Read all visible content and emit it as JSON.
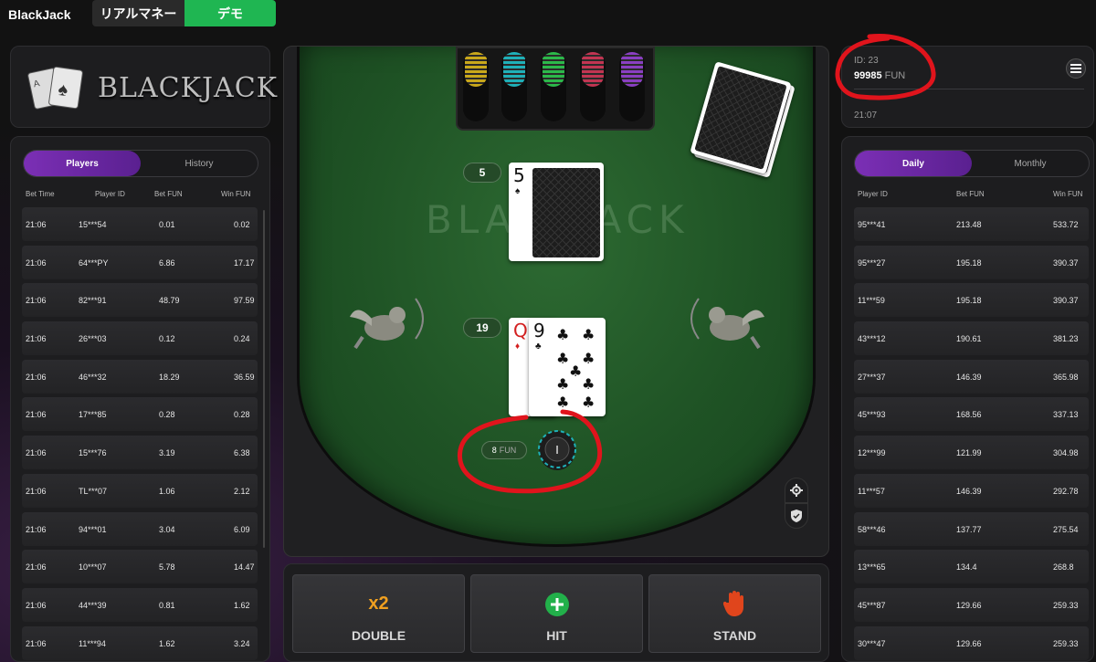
{
  "topbar": {
    "title": "BlackJack",
    "mode_real": "リアルマネー",
    "mode_demo": "デモ"
  },
  "logo": {
    "text": "BLACKJACK"
  },
  "left_board": {
    "tabs": [
      "Players",
      "History"
    ],
    "active_tab": "Players",
    "columns": [
      "Bet Time",
      "Player ID",
      "Bet FUN",
      "Win FUN"
    ],
    "rows": [
      [
        "21:06",
        "15***54",
        "0.01",
        "0.02"
      ],
      [
        "21:06",
        "64***PY",
        "6.86",
        "17.17"
      ],
      [
        "21:06",
        "82***91",
        "48.79",
        "97.59"
      ],
      [
        "21:06",
        "26***03",
        "0.12",
        "0.24"
      ],
      [
        "21:06",
        "46***32",
        "18.29",
        "36.59"
      ],
      [
        "21:06",
        "17***85",
        "0.28",
        "0.28"
      ],
      [
        "21:06",
        "15***76",
        "3.19",
        "6.38"
      ],
      [
        "21:06",
        "TL***07",
        "1.06",
        "2.12"
      ],
      [
        "21:06",
        "94***01",
        "3.04",
        "6.09"
      ],
      [
        "21:06",
        "10***07",
        "5.78",
        "14.47"
      ],
      [
        "21:06",
        "44***39",
        "0.81",
        "1.62"
      ],
      [
        "21:06",
        "11***94",
        "1.62",
        "3.24"
      ]
    ]
  },
  "account": {
    "id": "ID: 23",
    "balance": "99985",
    "unit": "FUN",
    "time": "21:07"
  },
  "right_board": {
    "tabs": [
      "Daily",
      "Monthly"
    ],
    "active_tab": "Daily",
    "columns": [
      "Player ID",
      "Bet FUN",
      "Win FUN"
    ],
    "rows": [
      [
        "95***41",
        "213.48",
        "533.72"
      ],
      [
        "95***27",
        "195.18",
        "390.37"
      ],
      [
        "11***59",
        "195.18",
        "390.37"
      ],
      [
        "43***12",
        "190.61",
        "381.23"
      ],
      [
        "27***37",
        "146.39",
        "365.98"
      ],
      [
        "45***93",
        "168.56",
        "337.13"
      ],
      [
        "12***99",
        "121.99",
        "304.98"
      ],
      [
        "11***57",
        "146.39",
        "292.78"
      ],
      [
        "58***46",
        "137.77",
        "275.54"
      ],
      [
        "13***65",
        "134.4",
        "268.8"
      ],
      [
        "45***87",
        "129.66",
        "259.33"
      ],
      [
        "30***47",
        "129.66",
        "259.33"
      ]
    ]
  },
  "table": {
    "watermark_title": "BLACKJACK",
    "dealer_score": "5",
    "dealer_card": {
      "rank": "5",
      "suit": "♠",
      "color": "#111111"
    },
    "player_score": "19",
    "player_cards": [
      {
        "rank": "Q",
        "suit": "♦",
        "color": "#d32020"
      },
      {
        "rank": "9",
        "suit": "♣",
        "color": "#111111"
      }
    ],
    "bet_amount": "8",
    "bet_unit": "FUN",
    "chip_label": "I"
  },
  "actions": {
    "double_label": "DOUBLE",
    "double_icon": "x2",
    "hit_label": "HIT",
    "stand_label": "STAND"
  },
  "colors": {
    "accent_purple": "#7b2fb5",
    "demo_green": "#1fb652",
    "felt_green": "#1f5325",
    "annotation_red": "#e0141c"
  }
}
